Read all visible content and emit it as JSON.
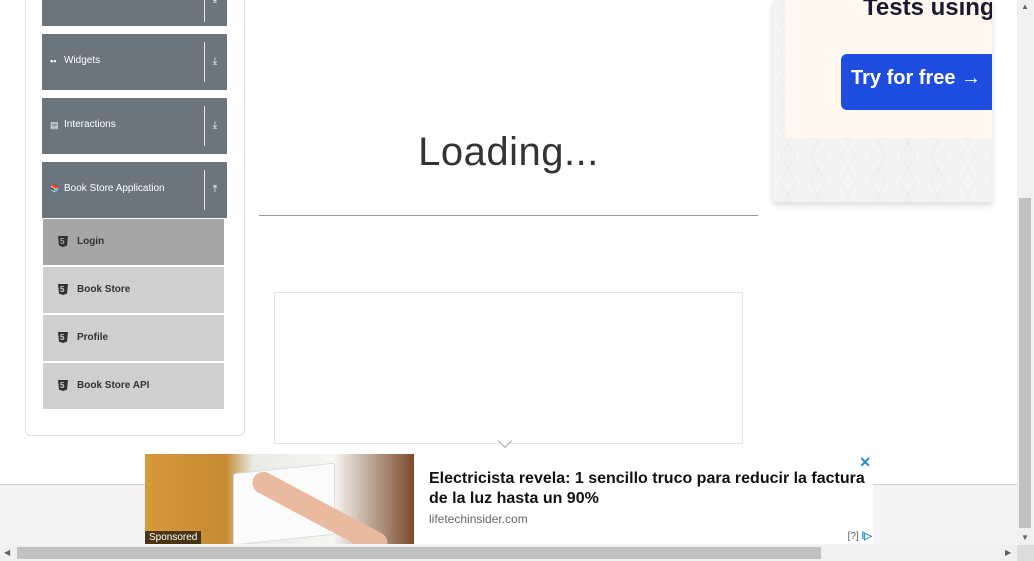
{
  "sidebar": {
    "partial_item": {
      "label": "",
      "arrow": "⤓"
    },
    "groups": [
      {
        "label": "Widgets",
        "icon": "widgets-grid-icon",
        "icon_glyph": "▪▪",
        "arrow": "⤓"
      },
      {
        "label": "Interactions",
        "icon": "interactions-icon",
        "icon_glyph": "▤",
        "arrow": "⤓"
      },
      {
        "label": "Book Store Application",
        "icon": "library-books-icon",
        "icon_glyph": "📚",
        "arrow": "⤒"
      }
    ],
    "items": [
      {
        "label": "Login",
        "icon": "html5-icon",
        "active": true
      },
      {
        "label": "Book Store",
        "icon": "html5-icon",
        "active": false
      },
      {
        "label": "Profile",
        "icon": "html5-icon",
        "active": false
      },
      {
        "label": "Book Store API",
        "icon": "html5-icon",
        "active": false
      }
    ]
  },
  "main": {
    "loading_text": "Loading..."
  },
  "ad_right": {
    "headline": "Tests using A",
    "cta": "Try for free →"
  },
  "banner_ad": {
    "title": "Electricista revela: 1 sencillo truco para reducir la factura de la luz hasta un 90%",
    "domain": "lifetechinsider.com",
    "sponsored": "Sponsored",
    "close": "✕",
    "adchoices": "[?]",
    "adchoices_icon": "ⅼ▷"
  },
  "scrollbars": {
    "left_arrow": "◀",
    "right_arrow": "▶",
    "up_arrow": "▲",
    "down_arrow": "▼"
  },
  "colors": {
    "group_header": "#6c757d",
    "menu_item": "#cfcfcf",
    "menu_item_active": "#a6a6a6",
    "cta_blue": "#1f4de0"
  }
}
